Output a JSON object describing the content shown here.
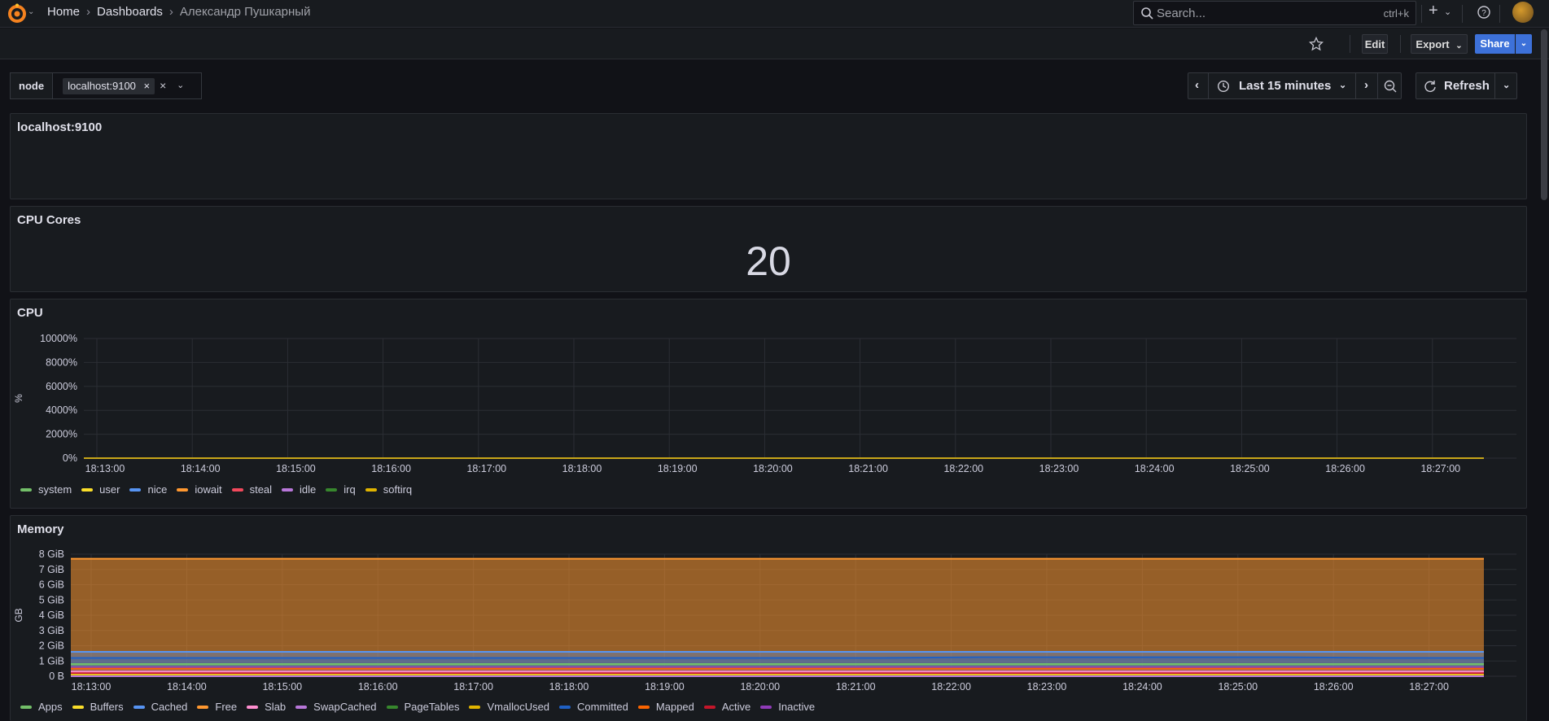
{
  "nav": {
    "breadcrumbs": [
      {
        "label": "Home"
      },
      {
        "label": "Dashboards"
      },
      {
        "label": "Александр Пушкарный"
      }
    ],
    "search_placeholder": "Search...",
    "search_shortcut": "ctrl+k"
  },
  "toolbar": {
    "edit_label": "Edit",
    "export_label": "Export",
    "share_label": "Share"
  },
  "variables": {
    "node_label": "node",
    "node_value": "localhost:9100"
  },
  "time": {
    "range_label": "Last 15 minutes",
    "refresh_label": "Refresh"
  },
  "panels": {
    "text_title": "localhost:9100",
    "cores_title": "CPU Cores",
    "cores_value": "20",
    "cpu_title": "CPU",
    "memory_title": "Memory"
  },
  "chart_data": [
    {
      "type": "line",
      "title": "CPU",
      "ylabel": "%",
      "ylim": [
        0,
        10000
      ],
      "yticks": [
        "0%",
        "2000%",
        "4000%",
        "6000%",
        "8000%",
        "10000%"
      ],
      "x": [
        "18:13:00",
        "18:14:00",
        "18:15:00",
        "18:16:00",
        "18:17:00",
        "18:18:00",
        "18:19:00",
        "18:20:00",
        "18:21:00",
        "18:22:00",
        "18:23:00",
        "18:24:00",
        "18:25:00",
        "18:26:00",
        "18:27:00"
      ],
      "series": [
        {
          "name": "system",
          "color": "#73bf69",
          "values": [
            0,
            0,
            0,
            0,
            0,
            0,
            0,
            0,
            0,
            0,
            0,
            0,
            0,
            0,
            0
          ]
        },
        {
          "name": "user",
          "color": "#fade2a",
          "values": [
            0,
            0,
            0,
            0,
            0,
            0,
            0,
            0,
            0,
            0,
            0,
            0,
            0,
            0,
            0
          ]
        },
        {
          "name": "nice",
          "color": "#5794f2",
          "values": [
            0,
            0,
            0,
            0,
            0,
            0,
            0,
            0,
            0,
            0,
            0,
            0,
            0,
            0,
            0
          ]
        },
        {
          "name": "iowait",
          "color": "#ff9830",
          "values": [
            0,
            0,
            0,
            0,
            0,
            0,
            0,
            0,
            0,
            0,
            0,
            0,
            0,
            0,
            0
          ]
        },
        {
          "name": "steal",
          "color": "#f2495c",
          "values": [
            0,
            0,
            0,
            0,
            0,
            0,
            0,
            0,
            0,
            0,
            0,
            0,
            0,
            0,
            0
          ]
        },
        {
          "name": "idle",
          "color": "#b877d9",
          "values": [
            0,
            0,
            0,
            0,
            0,
            0,
            0,
            0,
            0,
            0,
            0,
            0,
            0,
            0,
            0
          ]
        },
        {
          "name": "irq",
          "color": "#37872d",
          "values": [
            0,
            0,
            0,
            0,
            0,
            0,
            0,
            0,
            0,
            0,
            0,
            0,
            0,
            0,
            0
          ]
        },
        {
          "name": "softirq",
          "color": "#e0b400",
          "values": [
            0,
            0,
            0,
            0,
            0,
            0,
            0,
            0,
            0,
            0,
            0,
            0,
            0,
            0,
            0
          ]
        }
      ]
    },
    {
      "type": "area",
      "title": "Memory",
      "ylabel": "GB",
      "ylim": [
        0,
        8
      ],
      "yticks": [
        "0 B",
        "1 GiB",
        "2 GiB",
        "3 GiB",
        "4 GiB",
        "5 GiB",
        "6 GiB",
        "7 GiB",
        "8 GiB"
      ],
      "x": [
        "18:13:00",
        "18:14:00",
        "18:15:00",
        "18:16:00",
        "18:17:00",
        "18:18:00",
        "18:19:00",
        "18:20:00",
        "18:21:00",
        "18:22:00",
        "18:23:00",
        "18:24:00",
        "18:25:00",
        "18:26:00",
        "18:27:00"
      ],
      "series": [
        {
          "name": "Apps",
          "color": "#73bf69",
          "values": [
            0.8,
            0.8,
            0.8,
            0.8,
            0.8,
            0.8,
            0.8,
            0.8,
            0.8,
            0.8,
            0.8,
            0.8,
            0.8,
            0.8,
            0.8
          ]
        },
        {
          "name": "Buffers",
          "color": "#fade2a",
          "values": [
            0.1,
            0.1,
            0.1,
            0.1,
            0.1,
            0.1,
            0.1,
            0.1,
            0.1,
            0.1,
            0.1,
            0.1,
            0.1,
            0.1,
            0.1
          ]
        },
        {
          "name": "Cached",
          "color": "#5794f2",
          "values": [
            1.6,
            1.6,
            1.6,
            1.6,
            1.6,
            1.6,
            1.6,
            1.6,
            1.6,
            1.6,
            1.6,
            1.6,
            1.6,
            1.6,
            1.6
          ]
        },
        {
          "name": "Free",
          "color": "#ff9830",
          "values": [
            7.7,
            7.7,
            7.7,
            7.7,
            7.7,
            7.7,
            7.7,
            7.7,
            7.7,
            7.7,
            7.7,
            7.7,
            7.7,
            7.7,
            7.7
          ]
        },
        {
          "name": "Slab",
          "color": "#ff8fd0",
          "values": [
            0.3,
            0.3,
            0.3,
            0.3,
            0.3,
            0.3,
            0.3,
            0.3,
            0.3,
            0.3,
            0.3,
            0.3,
            0.3,
            0.3,
            0.3
          ]
        },
        {
          "name": "SwapCached",
          "color": "#b877d9",
          "values": [
            0,
            0,
            0,
            0,
            0,
            0,
            0,
            0,
            0,
            0,
            0,
            0,
            0,
            0,
            0
          ]
        },
        {
          "name": "PageTables",
          "color": "#37872d",
          "values": [
            0.05,
            0.05,
            0.05,
            0.05,
            0.05,
            0.05,
            0.05,
            0.05,
            0.05,
            0.05,
            0.05,
            0.05,
            0.05,
            0.05,
            0.05
          ]
        },
        {
          "name": "VmallocUsed",
          "color": "#e0b400",
          "values": [
            0.05,
            0.05,
            0.05,
            0.05,
            0.05,
            0.05,
            0.05,
            0.05,
            0.05,
            0.05,
            0.05,
            0.05,
            0.05,
            0.05,
            0.05
          ]
        },
        {
          "name": "Committed",
          "color": "#1f60c4",
          "values": [
            1.2,
            1.2,
            1.2,
            1.2,
            1.2,
            1.2,
            1.2,
            1.2,
            1.2,
            1.25,
            1.25,
            1.25,
            1.25,
            1.2,
            1.2
          ]
        },
        {
          "name": "Mapped",
          "color": "#fa6400",
          "values": [
            0.5,
            0.5,
            0.5,
            0.5,
            0.5,
            0.5,
            0.5,
            0.5,
            0.5,
            0.5,
            0.5,
            0.5,
            0.5,
            0.5,
            0.5
          ]
        },
        {
          "name": "Active",
          "color": "#c4162a",
          "values": [
            0.2,
            0.2,
            0.2,
            0.2,
            0.2,
            0.2,
            0.2,
            0.2,
            0.2,
            0.2,
            0.2,
            0.2,
            0.2,
            0.2,
            0.2
          ]
        },
        {
          "name": "Inactive",
          "color": "#8f3bb8",
          "values": [
            0.6,
            0.6,
            0.6,
            0.6,
            0.6,
            0.6,
            0.6,
            0.6,
            0.6,
            0.6,
            0.6,
            0.6,
            0.6,
            0.6,
            0.6
          ]
        }
      ]
    }
  ]
}
